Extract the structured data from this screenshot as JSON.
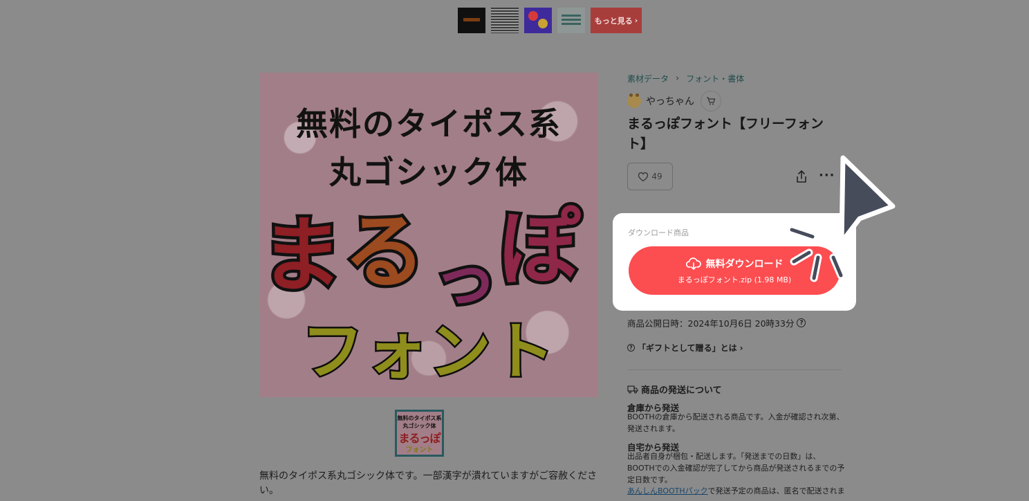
{
  "top_strip": {
    "more_label": "もっと見る"
  },
  "hero": {
    "line1": "無料のタイポス系",
    "line2": "丸ゴシック体",
    "title_chars": [
      "ま",
      "る",
      "っ",
      "ぽ"
    ],
    "line4": "フォント"
  },
  "mini_thumb": {
    "line1": "無料のタイポス系",
    "line2": "丸ゴシック体",
    "line3": "まるっぽ",
    "line4": "フォント"
  },
  "description": "無料のタイポス系丸ゴシック体です。一部漢字が潰れていますがご容赦ください。",
  "breadcrumb": {
    "items": [
      "素材データ",
      "フォント・書体"
    ]
  },
  "shop": {
    "name": "やっちゃん"
  },
  "product": {
    "title": "まるっぽフォント【フリーフォント】",
    "likes": "49"
  },
  "download": {
    "section_label": "ダウンロード商品",
    "button_label": "無料ダウンロード",
    "file_info": "まるっぽフォント.zip (1.98 MB)"
  },
  "publish": {
    "text": "商品公開日時：2024年10月6日 20時33分"
  },
  "gift": {
    "label": "「ギフトとして贈る」とは"
  },
  "shipping": {
    "heading": "商品の発送について",
    "warehouse_title": "倉庫から発送",
    "warehouse_body": "BOOTHの倉庫から配送される商品です。入金が確認され次第、発送されます。",
    "home_title": "自宅から発送",
    "home_body": "出品者自身が梱包・配送します。「発送までの日数」は、BOOTHでの入金確認が完了してから商品が発送されるまでの予定日数です。",
    "anshin_link": "あんしんBOOTHパック",
    "anshin_body": "で発送予定の商品は、匿名で配送されま"
  },
  "colors": {
    "overlay_bg": "#8b8b8b",
    "download_red": "#fc4d50",
    "link_teal": "#1f4c4c"
  }
}
